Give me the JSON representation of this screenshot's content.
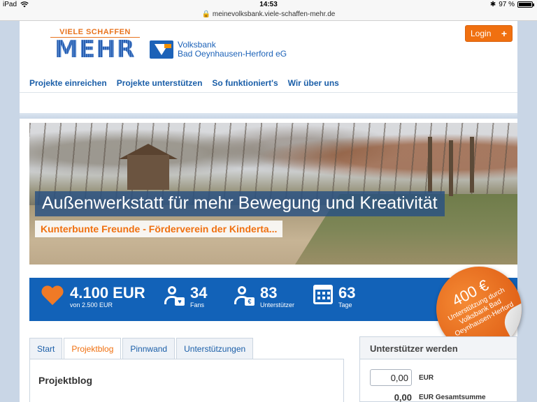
{
  "status_bar": {
    "device": "iPad",
    "time": "14:53",
    "battery": "97 %",
    "bluetooth_icon": "✱"
  },
  "browser": {
    "url": "meinevolksbank.viele-schaffen-mehr.de"
  },
  "header": {
    "logo_tagline": "VIELE SCHAFFEN",
    "logo_word": "MEHR",
    "bank_line1": "Volksbank",
    "bank_line2": "Bad Oeynhausen-Herford eG",
    "login_label": "Login",
    "login_plus": "+"
  },
  "nav": {
    "items": [
      "Projekte einreichen",
      "Projekte unterstützen",
      "So funktioniert's",
      "Wir über uns"
    ]
  },
  "hero": {
    "title": "Außenwerkstatt für mehr Bewegung und Kreativität",
    "subtitle": "Kunterbunte Freunde - Förderverein der Kinderta..."
  },
  "stats": {
    "amount": "4.100 EUR",
    "amount_sub": "von 2.500 EUR",
    "fans_count": "34",
    "fans_label": "Fans",
    "supporters_count": "83",
    "supporters_label": "Unterstützer",
    "days_count": "63",
    "days_label": "Tage",
    "currency_badge": "€"
  },
  "sticker": {
    "amount": "400 €",
    "text": "Unterstützung durch Volksbank Bad Oeynhausen-Herford"
  },
  "tabs": {
    "items": [
      "Start",
      "Projektblog",
      "Pinnwand",
      "Unterstützungen"
    ],
    "active": "Projektblog"
  },
  "panel": {
    "heading": "Projektblog"
  },
  "support": {
    "heading": "Unterstützer werden",
    "amount_value": "0,00",
    "amount_unit": "EUR",
    "total_value": "0,00",
    "total_label": "EUR Gesamtsumme"
  },
  "colors": {
    "brand_blue": "#1262b8",
    "accent_orange": "#f07010",
    "nav_blue": "#1a5ea8"
  }
}
